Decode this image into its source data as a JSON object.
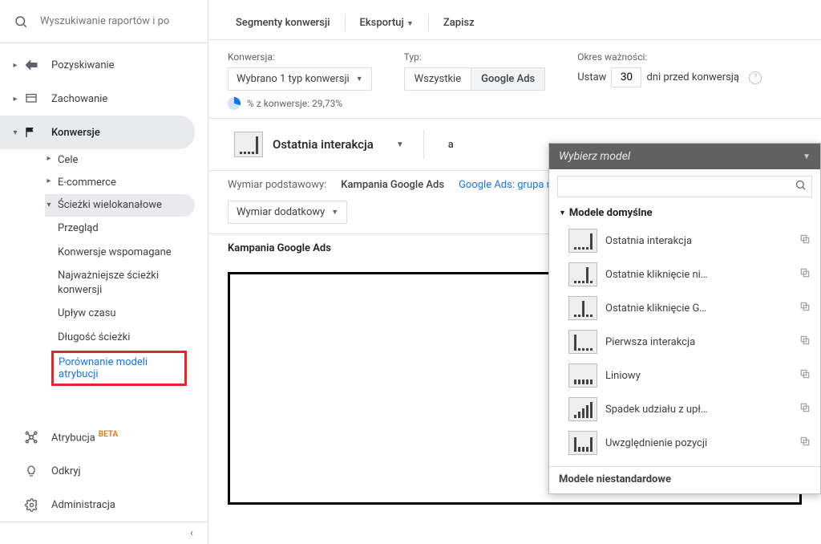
{
  "search": {
    "placeholder": "Wyszukiwanie raportów i po"
  },
  "nav": {
    "acquisition": "Pozyskiwanie",
    "behavior": "Zachowanie",
    "conversions": "Konwersje"
  },
  "conv_sub": {
    "goals": "Cele",
    "ecommerce": "E-commerce",
    "mcf": "Ścieżki\nwielokanałowe",
    "mcf_text": "Ścieżki wielokanałowe"
  },
  "mcf_sub": {
    "overview": "Przegląd",
    "assisted": "Konwersje wspomagane",
    "top_paths": "Najważniejsze ścieżki konwersji",
    "time_lag": "Upływ czasu",
    "path_length": "Długość ścieżki",
    "model_comparison": "Porównanie modeli atrybucji"
  },
  "bottom": {
    "attribution": "Atrybucja",
    "beta": "BETA",
    "discover": "Odkryj",
    "admin": "Administracja"
  },
  "toolbar": {
    "segments": "Segmenty konwersji",
    "export": "Eksportuj",
    "save": "Zapisz"
  },
  "filters": {
    "conversion_cap": "Konwersja:",
    "conversion_sel": "Wybrano 1 typ konwersji",
    "type_cap": "Typ:",
    "type_all": "Wszystkie",
    "type_gads": "Google Ads",
    "lookback_cap": "Okres ważności:",
    "lookback_set": "Ustaw",
    "lookback_days": "30",
    "lookback_suffix": "dni przed konwersją",
    "pct": "% z konwersje: 29,73%"
  },
  "model": {
    "name": "Ostatnia interakcja",
    "vs": "a"
  },
  "dims": {
    "primary_label": "Wymiar podstawowy:",
    "primary": "Kampania Google Ads",
    "secondary_link": "Google Ads: grupa reklam",
    "secondary_dd": "Wymiar dodatkowy"
  },
  "table": {
    "col1": "Kampania Google Ads"
  },
  "dropdown": {
    "title": "Wybierz model",
    "default_models": "Modele domyślne",
    "custom_models": "Modele niestandardowe",
    "items": {
      "last_interaction": "Ostatnia interakcja",
      "last_nondirect": "Ostatnie kliknięcie ni…",
      "last_gads": "Ostatnie kliknięcie G…",
      "first_interaction": "Pierwsza interakcja",
      "linear": "Liniowy",
      "time_decay": "Spadek udziału z upł…",
      "position": "Uwzględnienie pozycji"
    }
  }
}
